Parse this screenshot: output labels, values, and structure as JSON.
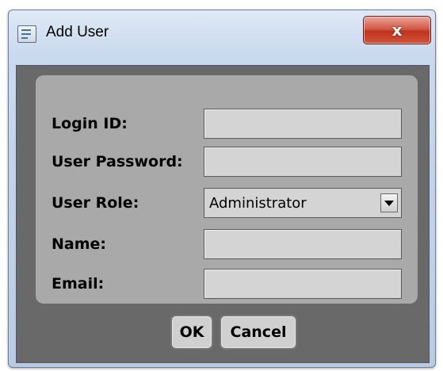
{
  "window": {
    "title": "Add User",
    "close_symbol": "x"
  },
  "form": {
    "login_id": {
      "label": "Login ID:",
      "value": ""
    },
    "password": {
      "label": "User Password:",
      "value": ""
    },
    "role": {
      "label": "User Role:",
      "value": "Administrator"
    },
    "name": {
      "label": "Name:",
      "value": ""
    },
    "email": {
      "label": "Email:",
      "value": ""
    }
  },
  "buttons": {
    "ok": "OK",
    "cancel": "Cancel"
  }
}
